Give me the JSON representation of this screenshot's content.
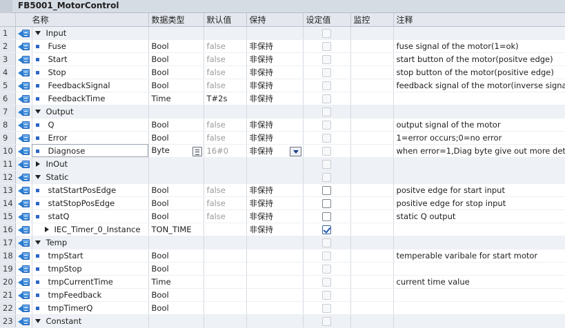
{
  "window": {
    "title": "FB5001_MotorControl"
  },
  "columns": {
    "name": "名称",
    "datatype": "数据类型",
    "default": "默认值",
    "retain": "保持",
    "setpoint": "设定值",
    "monitor": "监控",
    "comment": "注释"
  },
  "rows": [
    {
      "num": "1",
      "level": "section",
      "expand": "down",
      "name": "Input",
      "type": "",
      "default": "",
      "retain": "",
      "setpoint": "inactive",
      "comment": ""
    },
    {
      "num": "2",
      "level": "child",
      "name": "Fuse",
      "type": "Bool",
      "default": "false",
      "retain": "非保持",
      "setpoint": "inactive",
      "comment": "fuse signal of the motor(1=ok)"
    },
    {
      "num": "3",
      "level": "child",
      "name": "Start",
      "type": "Bool",
      "default": "false",
      "retain": "非保持",
      "setpoint": "inactive",
      "comment": "start button of the motor(positve edge)"
    },
    {
      "num": "4",
      "level": "child",
      "name": "Stop",
      "type": "Bool",
      "default": "false",
      "retain": "非保持",
      "setpoint": "inactive",
      "comment": "stop button of the motor(positive edge)"
    },
    {
      "num": "5",
      "level": "child",
      "name": "FeedbackSignal",
      "type": "Bool",
      "default": "false",
      "retain": "非保持",
      "setpoint": "inactive",
      "comment": "feedback signal of the motor(inverse signal ..."
    },
    {
      "num": "6",
      "level": "child",
      "name": "FeedbackTime",
      "type": "Time",
      "default": "T#2s",
      "retain": "非保持",
      "setpoint": "inactive",
      "comment": ""
    },
    {
      "num": "7",
      "level": "section",
      "expand": "down",
      "name": "Output",
      "type": "",
      "default": "",
      "retain": "",
      "setpoint": "inactive",
      "comment": ""
    },
    {
      "num": "8",
      "level": "child",
      "name": "Q",
      "type": "Bool",
      "default": "false",
      "retain": "非保持",
      "setpoint": "inactive",
      "comment": "output signal of the motor"
    },
    {
      "num": "9",
      "level": "child",
      "name": "Error",
      "type": "Bool",
      "default": "false",
      "retain": "非保持",
      "setpoint": "inactive",
      "comment": "1=error occurs;0=no error"
    },
    {
      "num": "10",
      "level": "child",
      "name": "Diagnose",
      "type": "Byte",
      "default": "16#0",
      "retain": "非保持",
      "setpoint": "inactive",
      "comment": "when error=1,Diag byte give out more deta...",
      "selected": true
    },
    {
      "num": "11",
      "level": "section",
      "expand": "right",
      "name": "InOut",
      "type": "",
      "default": "",
      "retain": "",
      "setpoint": "inactive",
      "comment": ""
    },
    {
      "num": "12",
      "level": "section",
      "expand": "down",
      "name": "Static",
      "type": "",
      "default": "",
      "retain": "",
      "setpoint": "inactive",
      "comment": ""
    },
    {
      "num": "13",
      "level": "child",
      "name": "statStartPosEdge",
      "type": "Bool",
      "default": "false",
      "retain": "非保持",
      "setpoint": "active",
      "comment": "positve edge for start input"
    },
    {
      "num": "14",
      "level": "child",
      "name": "statStopPosEdge",
      "type": "Bool",
      "default": "false",
      "retain": "非保持",
      "setpoint": "active",
      "comment": "positive edge for stop input"
    },
    {
      "num": "15",
      "level": "child",
      "name": "statQ",
      "type": "Bool",
      "default": "false",
      "retain": "非保持",
      "setpoint": "active",
      "comment": "static Q output"
    },
    {
      "num": "16",
      "level": "child-expand",
      "name": "IEC_Timer_0_Instance",
      "type": "TON_TIME",
      "default": "",
      "retain": "非保持",
      "setpoint": "checked",
      "comment": ""
    },
    {
      "num": "17",
      "level": "section",
      "expand": "down",
      "name": "Temp",
      "type": "",
      "default": "",
      "retain": "",
      "setpoint": "inactive",
      "comment": ""
    },
    {
      "num": "18",
      "level": "child",
      "name": "tmpStart",
      "type": "Bool",
      "default": "",
      "retain": "",
      "setpoint": "inactive",
      "comment": "temperable varibale for start motor"
    },
    {
      "num": "19",
      "level": "child",
      "name": "tmpStop",
      "type": "Bool",
      "default": "",
      "retain": "",
      "setpoint": "inactive",
      "comment": ""
    },
    {
      "num": "20",
      "level": "child",
      "name": "tmpCurrentTime",
      "type": "Time",
      "default": "",
      "retain": "",
      "setpoint": "inactive",
      "comment": "current time value"
    },
    {
      "num": "21",
      "level": "child",
      "name": "tmpFeedback",
      "type": "Bool",
      "default": "",
      "retain": "",
      "setpoint": "inactive",
      "comment": ""
    },
    {
      "num": "22",
      "level": "child",
      "name": "tmpTimerQ",
      "type": "Bool",
      "default": "",
      "retain": "",
      "setpoint": "inactive",
      "comment": ""
    },
    {
      "num": "23",
      "level": "section",
      "expand": "down",
      "name": "Constant",
      "type": "",
      "default": "",
      "retain": "",
      "setpoint": "inactive",
      "comment": ""
    }
  ]
}
